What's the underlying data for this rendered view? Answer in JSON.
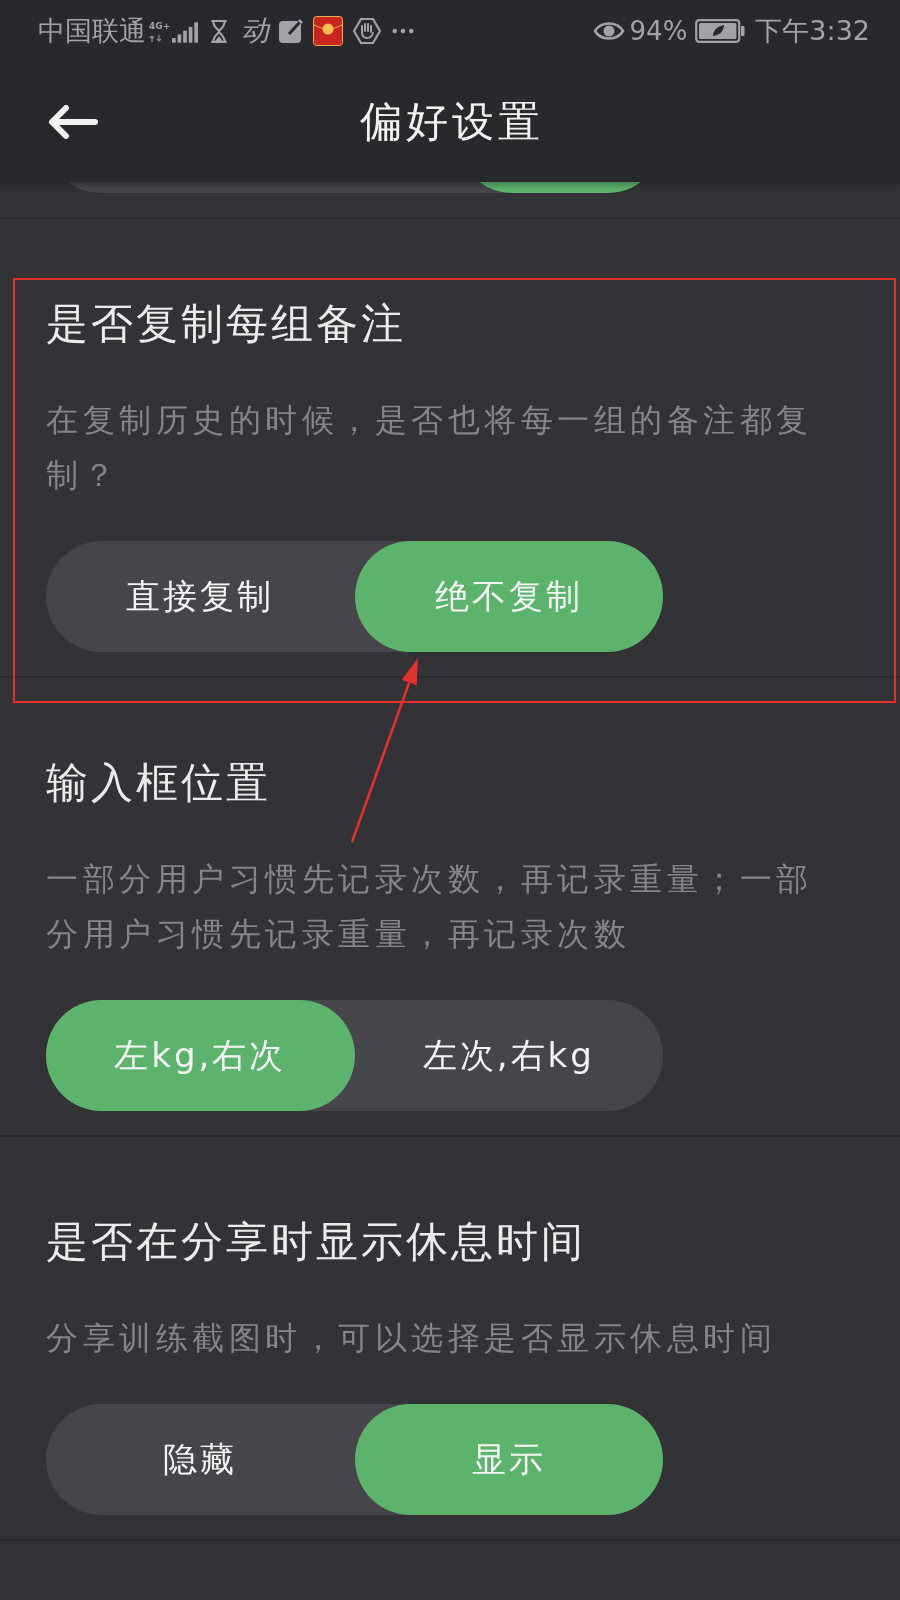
{
  "status_bar": {
    "carrier": "中国联通",
    "network": "4G+",
    "notification_text": "动",
    "battery": "94%",
    "time": "下午3:32"
  },
  "header": {
    "title": "偏好设置"
  },
  "cut_off_toggle": {
    "segments": [
      {
        "selected": false
      },
      {
        "selected": false
      },
      {
        "selected": true
      }
    ]
  },
  "sections": [
    {
      "title": "是否复制每组备注",
      "description": "在复制历史的时候，是否也将每一组的备注都复制？",
      "highlighted": true,
      "options": [
        {
          "label": "直接复制",
          "selected": false
        },
        {
          "label": "绝不复制",
          "selected": true
        }
      ]
    },
    {
      "title": "输入框位置",
      "description": "一部分用户习惯先记录次数，再记录重量；一部分用户习惯先记录重量，再记录次数",
      "highlighted": false,
      "options": [
        {
          "label": "左kg,右次",
          "selected": true
        },
        {
          "label": "左次,右kg",
          "selected": false
        }
      ]
    },
    {
      "title": "是否在分享时显示休息时间",
      "description": "分享训练截图时，可以选择是否显示休息时间",
      "highlighted": false,
      "options": [
        {
          "label": "隐藏",
          "selected": false
        },
        {
          "label": "显示",
          "selected": true
        }
      ]
    }
  ]
}
